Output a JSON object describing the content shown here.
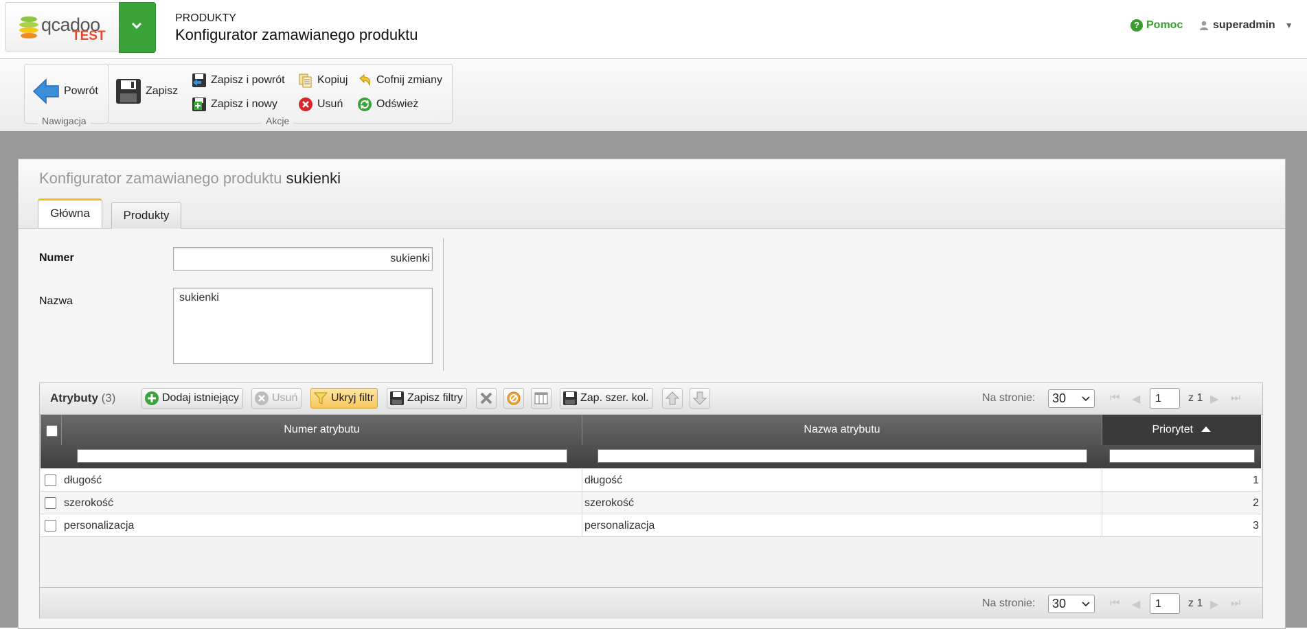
{
  "header": {
    "logo_word": "qcadoo",
    "logo_badge": "TEST",
    "section": "PRODUKTY",
    "title": "Konfigurator zamawianego produktu",
    "help_label": "Pomoc",
    "user_name": "superadmin"
  },
  "ribbon": {
    "nav_group_label": "Nawigacja",
    "actions_group_label": "Akcje",
    "back": "Powrót",
    "save": "Zapisz",
    "save_and_back": "Zapisz i powrót",
    "save_and_new": "Zapisz i nowy",
    "copy": "Kopiuj",
    "delete": "Usuń",
    "undo": "Cofnij zmiany",
    "refresh": "Odśwież"
  },
  "form": {
    "title_prefix": "Konfigurator zamawianego produktu",
    "title_name": "sukienki",
    "tabs": [
      {
        "label": "Główna",
        "active": true
      },
      {
        "label": "Produkty",
        "active": false
      }
    ],
    "number_label": "Numer",
    "number_value": "sukienki",
    "name_label": "Nazwa",
    "name_value": "sukienki"
  },
  "grid": {
    "title": "Atrybuty",
    "count": "(3)",
    "buttons": {
      "add_existing": "Dodaj istniejący",
      "delete": "Usuń",
      "hide_filter": "Ukryj filtr",
      "save_filters": "Zapisz filtry",
      "save_col_widths": "Zap. szer. kol."
    },
    "per_page_label": "Na stronie:",
    "per_page_value": "30",
    "page_value": "1",
    "page_of": "z 1",
    "columns": [
      {
        "label": "Numer atrybutu"
      },
      {
        "label": "Nazwa atrybutu"
      },
      {
        "label": "Priorytet",
        "sort": "asc"
      }
    ],
    "rows": [
      {
        "number": "długość",
        "name": "długość",
        "priority": "1"
      },
      {
        "number": "szerokość",
        "name": "szerokość",
        "priority": "2"
      },
      {
        "number": "personalizacja",
        "name": "personalizacja",
        "priority": "3"
      }
    ]
  },
  "colors": {
    "brand_green": "#3aa33a",
    "tab_accent": "#f0c019",
    "help_green": "#3a9e2e",
    "grid_header": "#4f4f4f"
  }
}
